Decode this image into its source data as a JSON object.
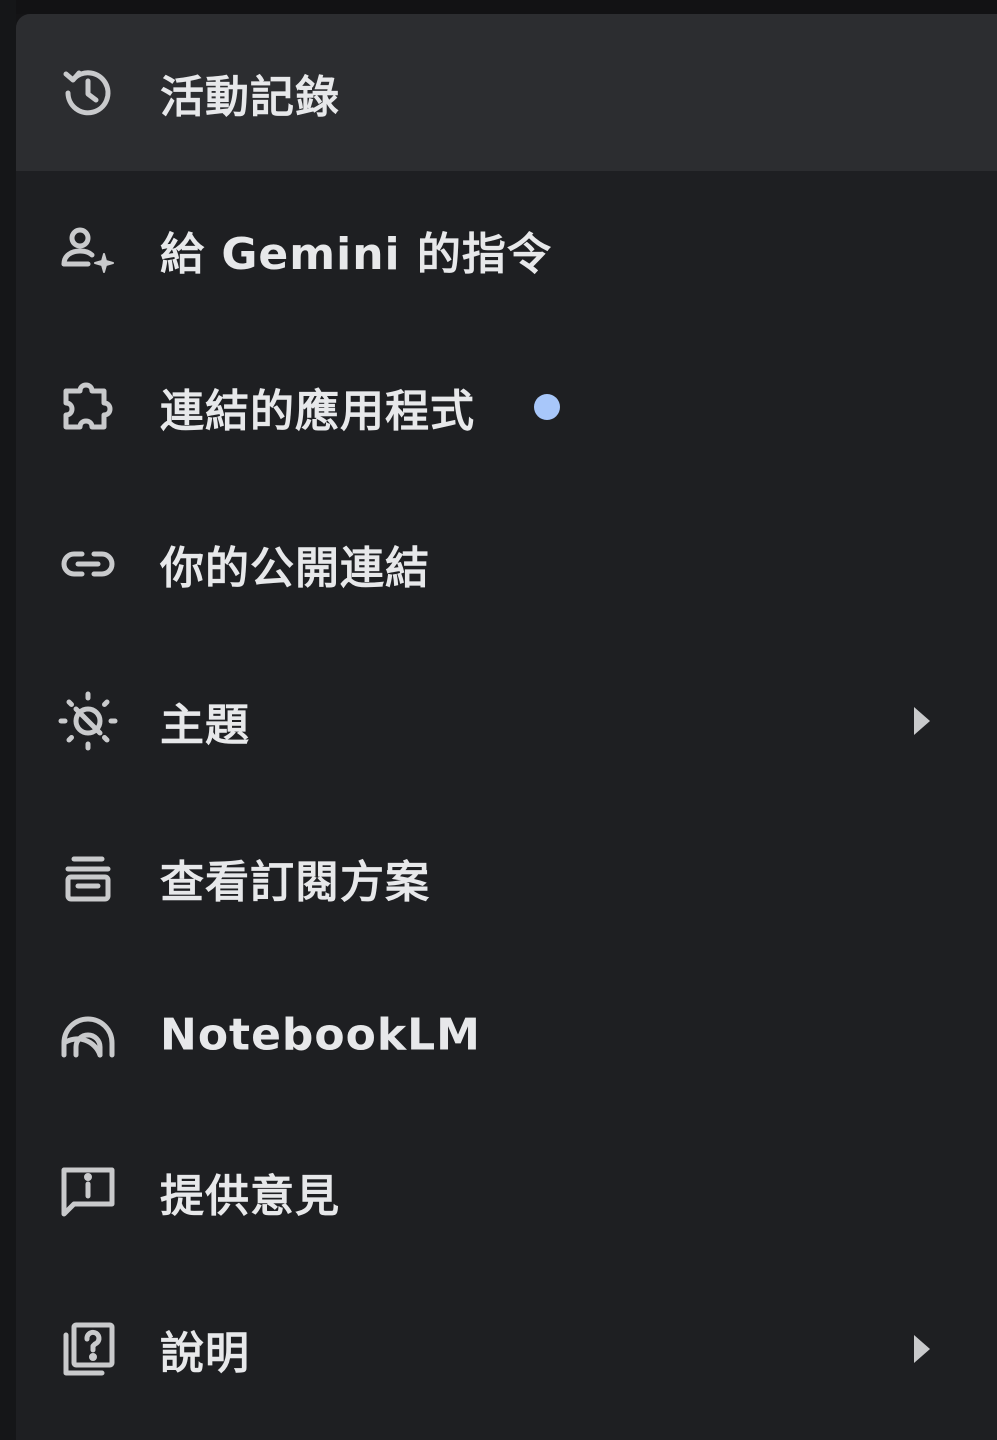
{
  "colors": {
    "menu_bg": "#1e1f22",
    "active_bg": "#2c2d30",
    "text": "#e7e8ea",
    "icon": "#c9cacc",
    "badge_dot": "#a8c7fa"
  },
  "menu": {
    "items": [
      {
        "label": "活動記錄",
        "icon": "history-icon",
        "active": true
      },
      {
        "label": "給 Gemini 的指令",
        "icon": "person-sparkle-icon"
      },
      {
        "label": "連結的應用程式",
        "icon": "puzzle-icon",
        "badge": "dot"
      },
      {
        "label": "你的公開連結",
        "icon": "link-icon"
      },
      {
        "label": "主題",
        "icon": "theme-sun-icon",
        "submenu": true
      },
      {
        "label": "查看訂閱方案",
        "icon": "subscription-icon"
      },
      {
        "label": "NotebookLM",
        "icon": "notebooklm-icon"
      },
      {
        "label": "提供意見",
        "icon": "feedback-icon"
      },
      {
        "label": "說明",
        "icon": "help-icon",
        "submenu": true
      }
    ]
  }
}
